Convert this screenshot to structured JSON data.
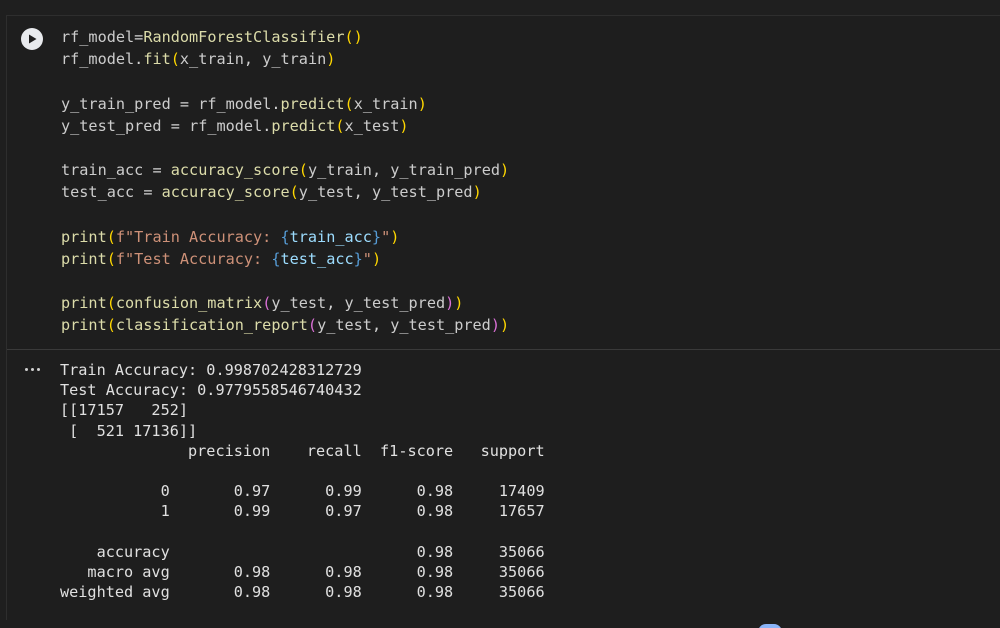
{
  "cell": {
    "code_lines": [
      "rf_model=RandomForestClassifier()",
      "rf_model.fit(x_train, y_train)",
      "",
      "y_train_pred = rf_model.predict(x_train)",
      "y_test_pred = rf_model.predict(x_test)",
      "",
      "train_acc = accuracy_score(y_train, y_train_pred)",
      "test_acc = accuracy_score(y_test, y_test_pred)",
      "",
      "print(f\"Train Accuracy: {train_acc}\")",
      "print(f\"Test Accuracy: {test_acc}\")",
      "",
      "print(confusion_matrix(y_test, y_test_pred))",
      "print(classification_report(y_test, y_test_pred))"
    ],
    "run_icon": "play-icon",
    "output_menu_icon": "more-horizontal-icon"
  },
  "output": {
    "lines": [
      "Train Accuracy: 0.998702428312729",
      "Test Accuracy: 0.9779558546740432",
      "[[17157   252]",
      " [  521 17136]]",
      "              precision    recall  f1-score   support",
      "",
      "           0       0.97      0.99      0.98     17409",
      "           1       0.99      0.97      0.98     17657",
      "",
      "    accuracy                           0.98     35066",
      "   macro avg       0.98      0.98      0.98     35066",
      "weighted avg       0.98      0.98      0.98     35066"
    ]
  },
  "colors": {
    "background": "#1f1f1f",
    "cell_background": "#1e1e1e",
    "run_button": "#e8eaed",
    "function": "#dcdcaa",
    "string": "#ce9178",
    "paren": "#ffd700"
  }
}
